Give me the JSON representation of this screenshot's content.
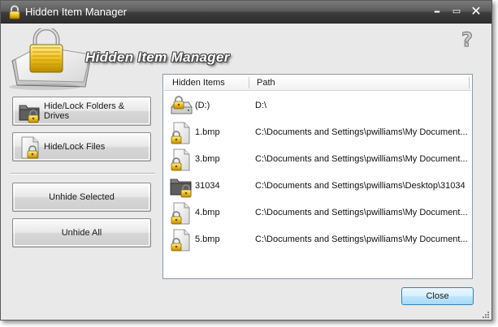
{
  "window": {
    "title": "Hidden Item Manager",
    "controls": {
      "minimize": "–",
      "maximize": "▭",
      "close": "✕"
    }
  },
  "banner": {
    "title": "Hidden Item Manager"
  },
  "help": {
    "glyph": "?"
  },
  "actions": {
    "hide_folders_label": "Hide/Lock Folders & Drives",
    "hide_files_label": "Hide/Lock Files",
    "unhide_selected_label": "Unhide Selected",
    "unhide_all_label": "Unhide All"
  },
  "list": {
    "columns": [
      "Hidden Items",
      "Path"
    ],
    "rows": [
      {
        "name": "(D:)",
        "path": "D:\\",
        "icon": "drive-lock-icon"
      },
      {
        "name": "1.bmp",
        "path": "C:\\Documents and Settings\\pwilliams\\My Document...",
        "icon": "file-lock-icon"
      },
      {
        "name": "3.bmp",
        "path": "C:\\Documents and Settings\\pwilliams\\My Document...",
        "icon": "file-lock-icon"
      },
      {
        "name": "31034",
        "path": "C:\\Documents and Settings\\pwilliams\\Desktop\\31034",
        "icon": "folder-lock-icon"
      },
      {
        "name": "4.bmp",
        "path": "C:\\Documents and Settings\\pwilliams\\My Document...",
        "icon": "file-lock-icon"
      },
      {
        "name": "5.bmp",
        "path": "C:\\Documents and Settings\\pwilliams\\My Document...",
        "icon": "file-lock-icon"
      }
    ]
  },
  "footer": {
    "close_label": "Close"
  },
  "colors": {
    "lock_gold": "#e8b820",
    "list_border": "#8a9aac",
    "close_border": "#3c7fb1"
  }
}
